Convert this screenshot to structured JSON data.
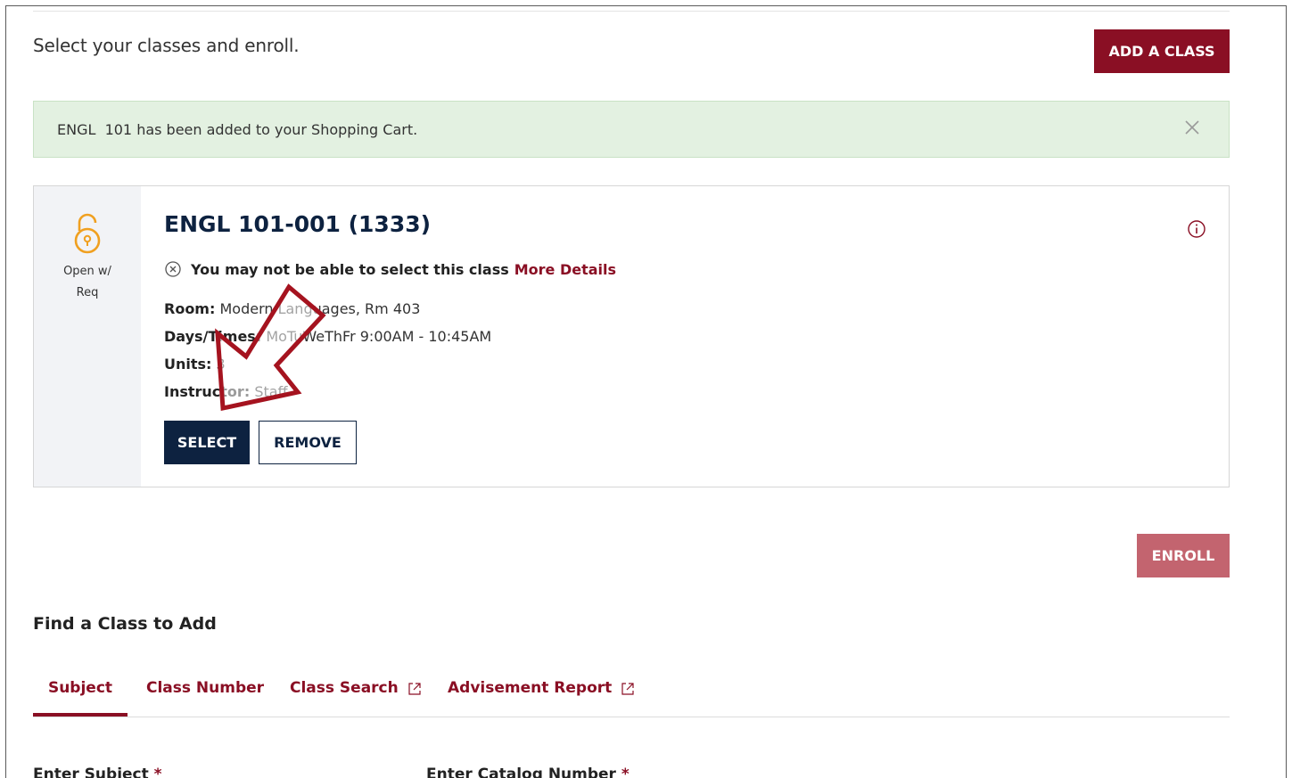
{
  "intro": "Select your classes and enroll.",
  "add_class_label": "ADD A CLASS",
  "alert": {
    "message": "ENGL  101 has been added to your Shopping Cart."
  },
  "class_card": {
    "status_line1": "Open w/",
    "status_line2": "Req",
    "title": "ENGL 101-001 (1333)",
    "warning": "You may not be able to select this class",
    "more_details": "More Details",
    "room_label": "Room:",
    "room_value": "Modern Languages, Rm 403",
    "days_label": "Days/Times:",
    "days_value": "MoTuWeThFr 9:00AM - 10:45AM",
    "units_label": "Units:",
    "units_value": "3",
    "instructor_label": "Instructor:",
    "instructor_value": "Staff",
    "select_label": "SELECT",
    "remove_label": "REMOVE"
  },
  "enroll_label": "ENROLL",
  "find_title": "Find a Class to Add",
  "tabs": [
    {
      "label": "Subject"
    },
    {
      "label": "Class Number"
    },
    {
      "label": "Class Search"
    },
    {
      "label": "Advisement Report"
    }
  ],
  "fields": {
    "subject_label": "Enter Subject",
    "catalog_label": "Enter Catalog Number",
    "required_mark": "*"
  },
  "colors": {
    "maroon": "#8a0f24",
    "navy": "#0d2240",
    "alert_bg": "#e3f1e1",
    "lock_orange": "#f0a020"
  }
}
